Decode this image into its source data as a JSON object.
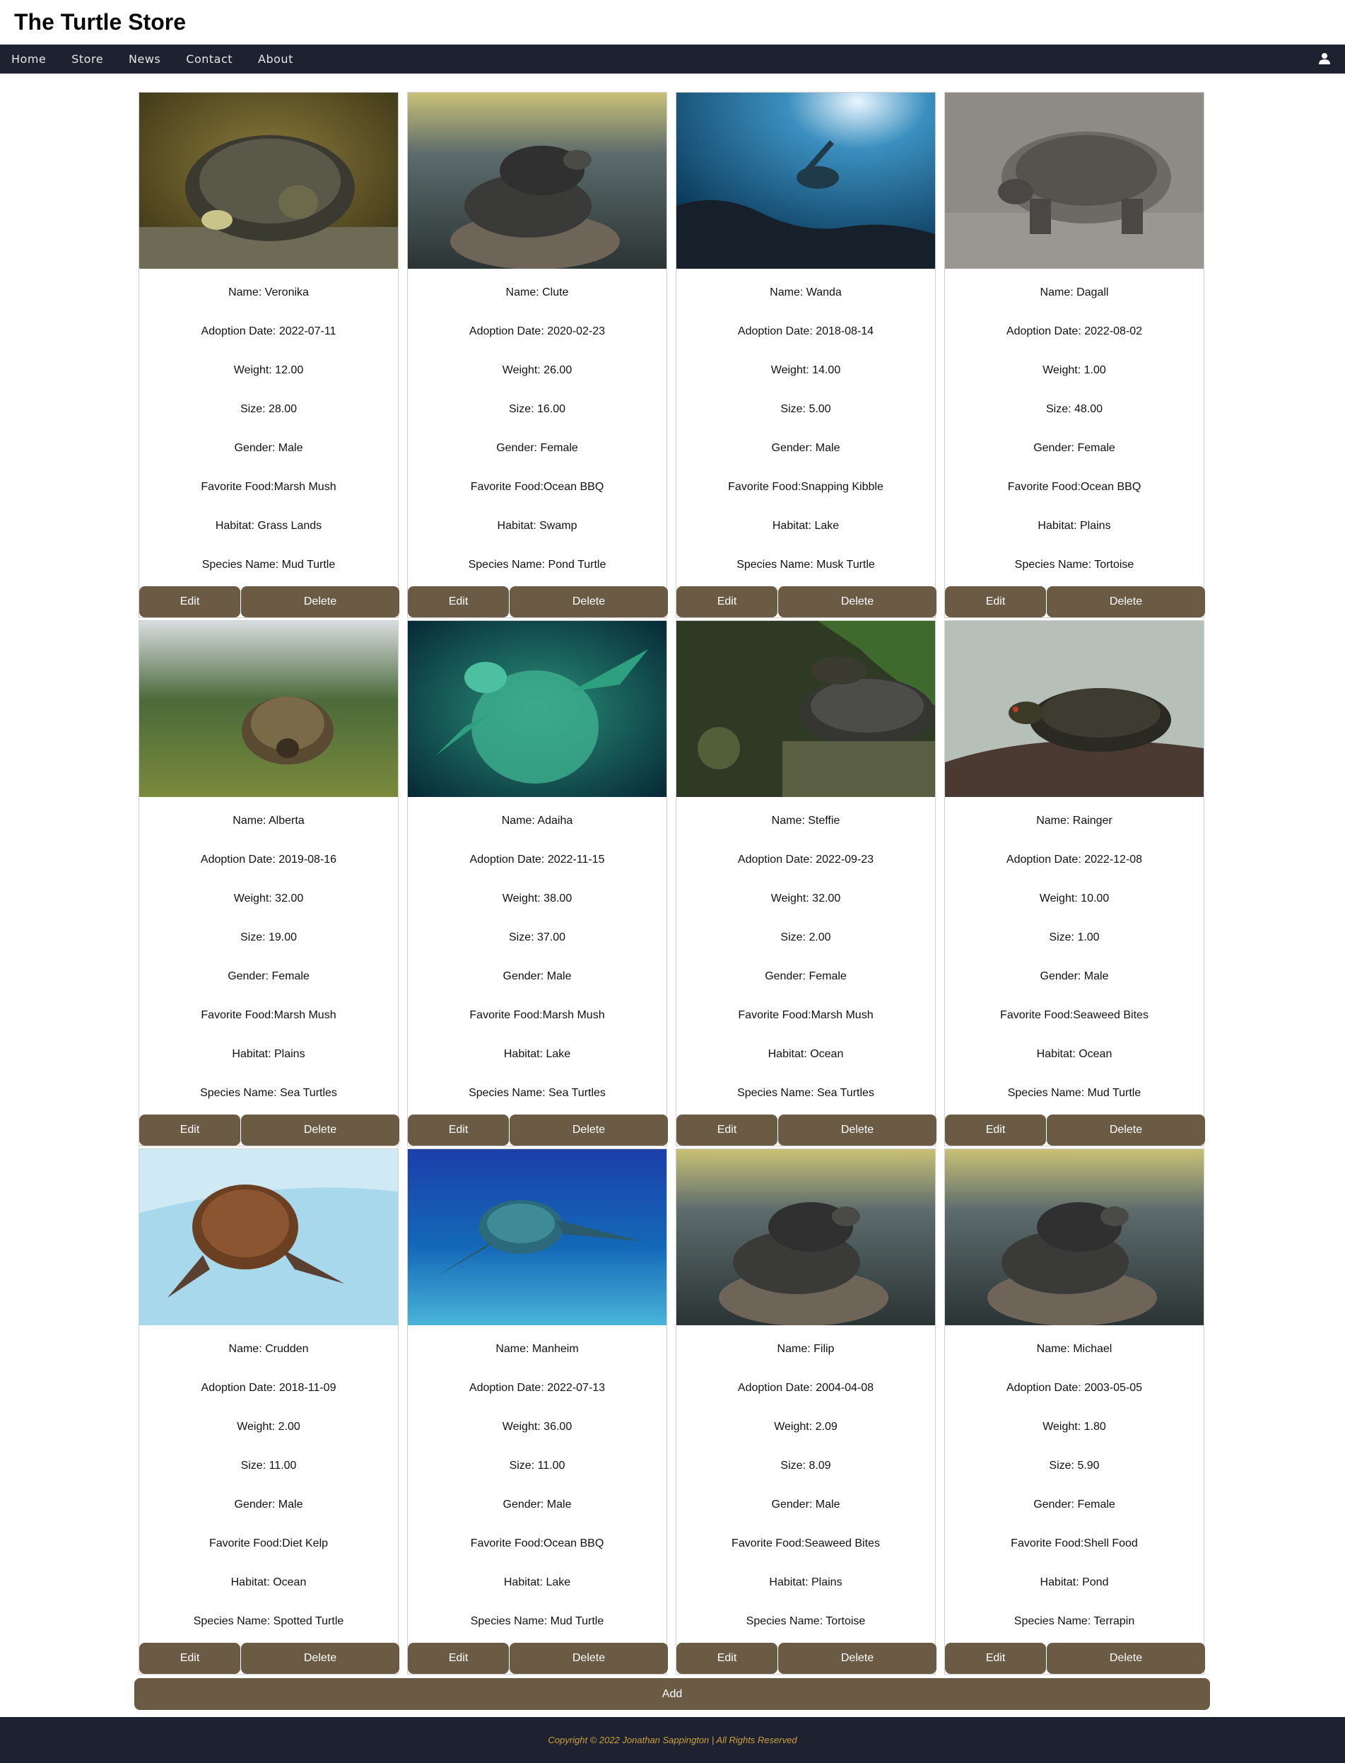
{
  "header": {
    "title": "The Turtle Store"
  },
  "nav": {
    "items": [
      "Home",
      "Store",
      "News",
      "Contact",
      "About"
    ],
    "user_icon": "user-icon"
  },
  "turtles": [
    {
      "name": "Name: Veronika",
      "adoption": "Adoption Date: 2022-07-11",
      "weight": "Weight: 12.00",
      "size": "Size: 28.00",
      "gender": "Gender: Male",
      "food": "Favorite Food:Marsh Mush",
      "habitat": "Habitat: Grass Lands",
      "species": "Species Name: Mud Turtle",
      "image": "photo-turtle-on-moss"
    },
    {
      "name": "Name: Clute",
      "adoption": "Adoption Date: 2020-02-23",
      "weight": "Weight: 26.00",
      "size": "Size: 16.00",
      "gender": "Gender: Female",
      "food": "Favorite Food:Ocean BBQ",
      "habitat": "Habitat: Swamp",
      "species": "Species Name: Pond Turtle",
      "image": "photo-stacked-turtles-on-rock"
    },
    {
      "name": "Name: Wanda",
      "adoption": "Adoption Date: 2018-08-14",
      "weight": "Weight: 14.00",
      "size": "Size: 5.00",
      "gender": "Gender: Male",
      "food": "Favorite Food:Snapping Kibble",
      "habitat": "Habitat: Lake",
      "species": "Species Name: Musk Turtle",
      "image": "photo-sea-turtle-underwater"
    },
    {
      "name": "Name: Dagall",
      "adoption": "Adoption Date: 2022-08-02",
      "weight": "Weight: 1.00",
      "size": "Size: 48.00",
      "gender": "Gender: Female",
      "food": "Favorite Food:Ocean BBQ",
      "habitat": "Habitat: Plains",
      "species": "Species Name: Tortoise",
      "image": "photo-giant-tortoise"
    },
    {
      "name": "Name: Alberta",
      "adoption": "Adoption Date: 2019-08-16",
      "weight": "Weight: 32.00",
      "size": "Size: 19.00",
      "gender": "Gender: Female",
      "food": "Favorite Food:Marsh Mush",
      "habitat": "Habitat: Plains",
      "species": "Species Name: Sea Turtles",
      "image": "photo-tortoise-in-grass"
    },
    {
      "name": "Name: Adaiha",
      "adoption": "Adoption Date: 2022-11-15",
      "weight": "Weight: 38.00",
      "size": "Size: 37.00",
      "gender": "Gender: Male",
      "food": "Favorite Food:Marsh Mush",
      "habitat": "Habitat: Lake",
      "species": "Species Name: Sea Turtles",
      "image": "photo-green-sea-turtle"
    },
    {
      "name": "Name: Steffie",
      "adoption": "Adoption Date: 2022-09-23",
      "weight": "Weight: 32.00",
      "size": "Size: 2.00",
      "gender": "Gender: Female",
      "food": "Favorite Food:Marsh Mush",
      "habitat": "Habitat: Ocean",
      "species": "Species Name: Sea Turtles",
      "image": "photo-turtles-on-rock-leaves"
    },
    {
      "name": "Name: Rainger",
      "adoption": "Adoption Date: 2022-12-08",
      "weight": "Weight: 10.00",
      "size": "Size: 1.00",
      "gender": "Gender: Male",
      "food": "Favorite Food:Seaweed Bites",
      "habitat": "Habitat: Ocean",
      "species": "Species Name: Mud Turtle",
      "image": "photo-red-eared-slider"
    },
    {
      "name": "Name: Crudden",
      "adoption": "Adoption Date: 2018-11-09",
      "weight": "Weight: 2.00",
      "size": "Size: 11.00",
      "gender": "Gender: Male",
      "food": "Favorite Food:Diet Kelp",
      "habitat": "Habitat: Ocean",
      "species": "Species Name: Spotted Turtle",
      "image": "photo-turtle-in-pool"
    },
    {
      "name": "Name: Manheim",
      "adoption": "Adoption Date: 2022-07-13",
      "weight": "Weight: 36.00",
      "size": "Size: 11.00",
      "gender": "Gender: Male",
      "food": "Favorite Food:Ocean BBQ",
      "habitat": "Habitat: Lake",
      "species": "Species Name: Mud Turtle",
      "image": "photo-sea-turtle-blue-water"
    },
    {
      "name": "Name: Filip",
      "adoption": "Adoption Date: 2004-04-08",
      "weight": "Weight: 2.09",
      "size": "Size: 8.09",
      "gender": "Gender: Male",
      "food": "Favorite Food:Seaweed Bites",
      "habitat": "Habitat: Plains",
      "species": "Species Name: Tortoise",
      "image": "photo-stacked-turtles-on-rock"
    },
    {
      "name": "Name: Michael",
      "adoption": "Adoption Date: 2003-05-05",
      "weight": "Weight: 1.80",
      "size": "Size: 5.90",
      "gender": "Gender: Female",
      "food": "Favorite Food:Shell Food",
      "habitat": "Habitat: Pond",
      "species": "Species Name: Terrapin",
      "image": "photo-stacked-turtles-on-rock"
    }
  ],
  "buttons": {
    "edit": "Edit",
    "delete": "Delete",
    "add": "Add"
  },
  "footer": {
    "copyright": "Copyright © 2022 Jonathan Sappington | All Rights Reserved"
  },
  "colors": {
    "nav_bg": "#1e2230",
    "button_bg": "#6b5b45",
    "footer_text": "#c9a03a"
  }
}
